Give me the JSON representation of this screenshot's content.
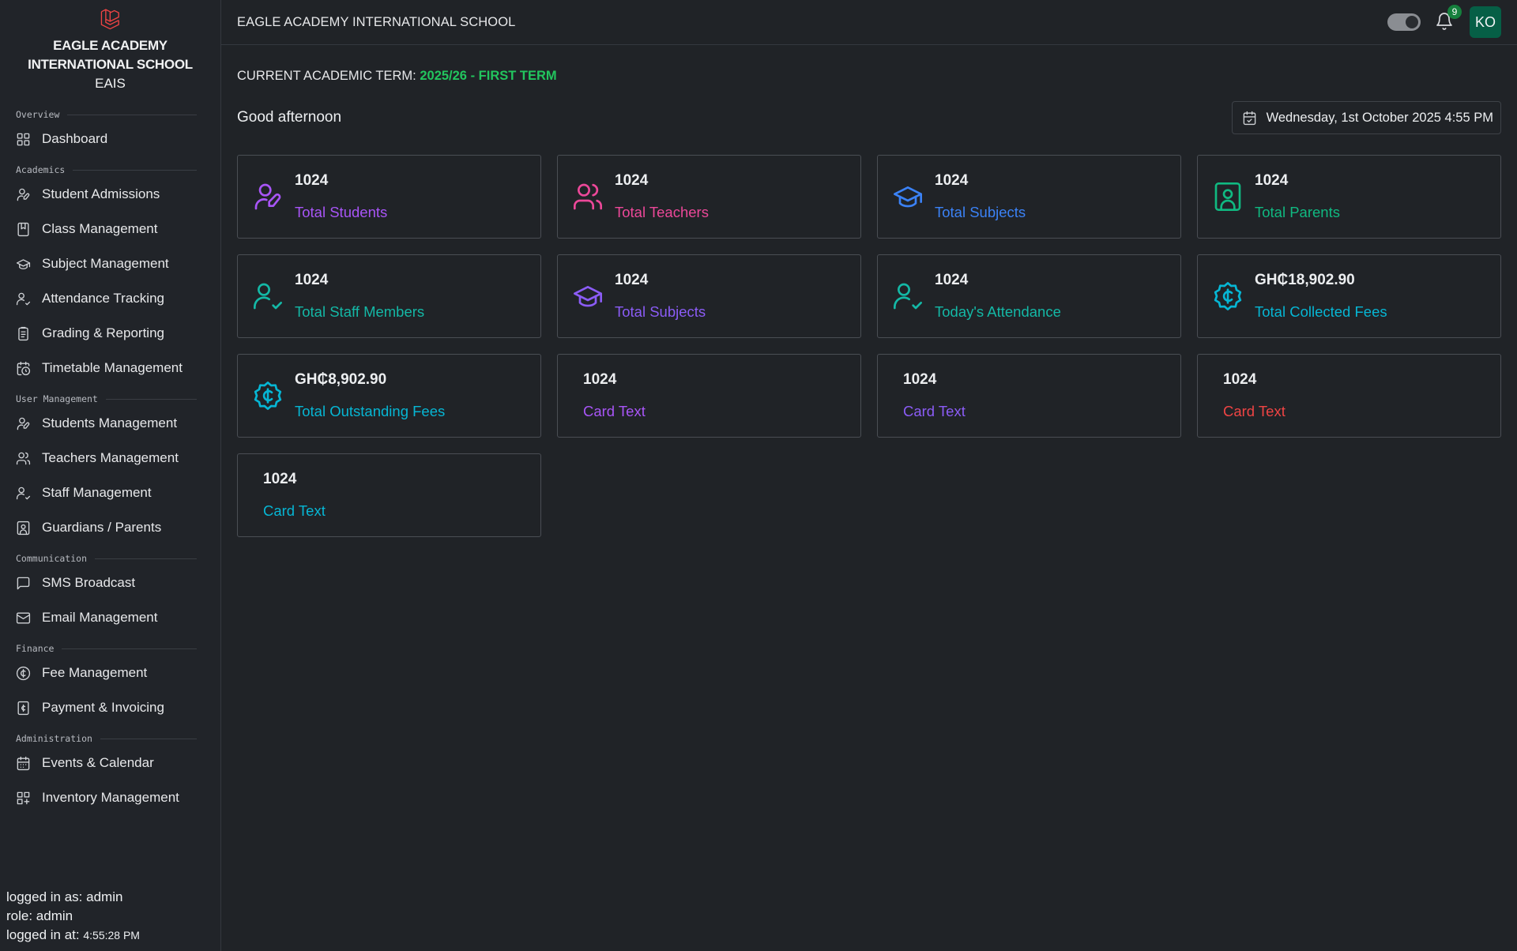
{
  "sidebar": {
    "brand_name": "EAGLE ACADEMY INTERNATIONAL SCHOOL",
    "brand_short": "EAIS",
    "sections": [
      {
        "title": "Overview",
        "items": [
          {
            "label": "Dashboard",
            "icon": "dashboard-icon"
          }
        ]
      },
      {
        "title": "Academics",
        "items": [
          {
            "label": "Student Admissions",
            "icon": "user-pen-icon"
          },
          {
            "label": "Class Management",
            "icon": "bookmark-icon"
          },
          {
            "label": "Subject Management",
            "icon": "graduation-cap-icon"
          },
          {
            "label": "Attendance Tracking",
            "icon": "user-check-icon"
          },
          {
            "label": "Grading & Reporting",
            "icon": "clipboard-icon"
          },
          {
            "label": "Timetable Management",
            "icon": "calendar-clock-icon"
          }
        ]
      },
      {
        "title": "User Management",
        "items": [
          {
            "label": "Students Management",
            "icon": "user-pen-icon"
          },
          {
            "label": "Teachers Management",
            "icon": "users-icon"
          },
          {
            "label": "Staff Management",
            "icon": "user-check-icon"
          },
          {
            "label": "Guardians / Parents",
            "icon": "contact-icon"
          }
        ]
      },
      {
        "title": "Communication",
        "items": [
          {
            "label": "SMS Broadcast",
            "icon": "message-icon"
          },
          {
            "label": "Email Management",
            "icon": "mail-icon"
          }
        ]
      },
      {
        "title": "Finance",
        "items": [
          {
            "label": "Fee Management",
            "icon": "cedi-circle-icon"
          },
          {
            "label": "Payment & Invoicing",
            "icon": "receipt-icon"
          }
        ]
      },
      {
        "title": "Administration",
        "items": [
          {
            "label": "Events & Calendar",
            "icon": "calendar-icon"
          },
          {
            "label": "Inventory Management",
            "icon": "grid-plus-icon"
          }
        ]
      }
    ],
    "session": {
      "logged_in_as": "logged in as: admin",
      "role": "role: admin",
      "logged_in_at_label": "logged in at: ",
      "logged_in_at_time": "4:55:28 PM"
    }
  },
  "header": {
    "title": "EAGLE ACADEMY INTERNATIONAL SCHOOL",
    "notification_count": "9",
    "avatar_initials": "KO"
  },
  "main": {
    "term_label": "CURRENT ACADEMIC TERM: ",
    "term_value": "2025/26 - FIRST TERM",
    "greeting": "Good afternoon",
    "date": "Wednesday, 1st October 2025 4:55 PM",
    "cards": [
      {
        "value": "1024",
        "label": "Total Students",
        "color": "#a855f7",
        "icon": "user-pen-icon",
        "name": "total-students-card"
      },
      {
        "value": "1024",
        "label": "Total Teachers",
        "color": "#ec4899",
        "icon": "users-icon",
        "name": "total-teachers-card"
      },
      {
        "value": "1024",
        "label": "Total Subjects",
        "color": "#3b82f6",
        "icon": "graduation-cap-icon",
        "name": "total-subjects-card"
      },
      {
        "value": "1024",
        "label": "Total Parents",
        "color": "#10b981",
        "icon": "contact-icon",
        "name": "total-parents-card"
      },
      {
        "value": "1024",
        "label": "Total Staff Members",
        "color": "#14b8a6",
        "icon": "user-check-icon",
        "name": "total-staff-card"
      },
      {
        "value": "1024",
        "label": "Total Subjects",
        "color": "#8b5cf6",
        "icon": "graduation-cap-icon",
        "name": "total-subjects-card-2"
      },
      {
        "value": "1024",
        "label": "Today's Attendance",
        "color": "#14b8a6",
        "icon": "user-check-icon",
        "name": "todays-attendance-card"
      },
      {
        "value": "GH₵18,902.90",
        "label": "Total Collected Fees",
        "color": "#06b6d4",
        "icon": "cedi-badge-icon",
        "name": "collected-fees-card"
      },
      {
        "value": "GH₵8,902.90",
        "label": "Total Outstanding Fees",
        "color": "#06b6d4",
        "icon": "cedi-badge-icon",
        "name": "outstanding-fees-card"
      },
      {
        "value": "1024",
        "label": "Card Text",
        "color": "#a855f7",
        "icon": "",
        "name": "card-text-1"
      },
      {
        "value": "1024",
        "label": "Card Text",
        "color": "#8b5cf6",
        "icon": "",
        "name": "card-text-2"
      },
      {
        "value": "1024",
        "label": "Card Text",
        "color": "#ef4444",
        "icon": "",
        "name": "card-text-3"
      },
      {
        "value": "1024",
        "label": "Card Text",
        "color": "#06b6d4",
        "icon": "",
        "name": "card-text-4"
      }
    ]
  }
}
